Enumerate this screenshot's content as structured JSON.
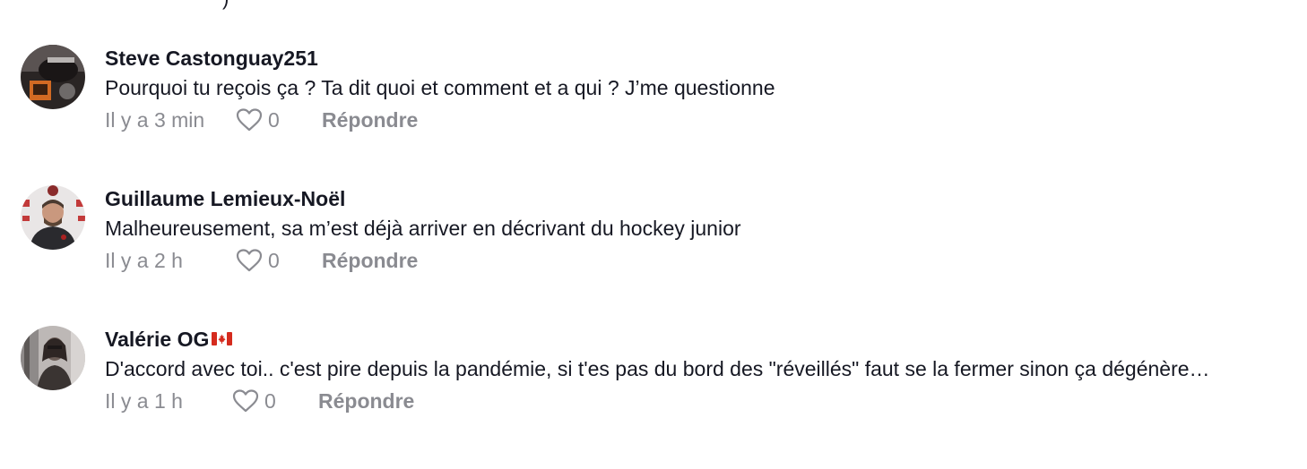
{
  "top_fragment": ")",
  "comments": [
    {
      "author": "Steve Castonguay251",
      "text": "Pourquoi tu reçois ça ? Ta dit quoi et comment et a qui ? J’me questionne",
      "time": "Il y a 3 min",
      "likes": "0",
      "reply_label": "Répondre",
      "like_icon": "heart-outline-icon"
    },
    {
      "author": "Guillaume Lemieux-Noël",
      "text": "Malheureusement, sa m’est déjà arriver en décrivant du hockey junior",
      "time": "Il y a 2 h",
      "likes": "0",
      "reply_label": "Répondre",
      "like_icon": "heart-outline-icon"
    },
    {
      "author": "Valérie OG",
      "author_badge": "canada-flag-icon",
      "text": "D'accord avec toi.. c'est pire depuis la pandémie, si t'es pas du bord des \"réveillés\" faut se la fermer sinon ça dégénère…",
      "time": "Il y a 1 h",
      "likes": "0",
      "reply_label": "Répondre",
      "like_icon": "heart-outline-icon"
    }
  ],
  "colors": {
    "text": "#161823",
    "muted": "#8a8b91",
    "background": "#ffffff"
  }
}
